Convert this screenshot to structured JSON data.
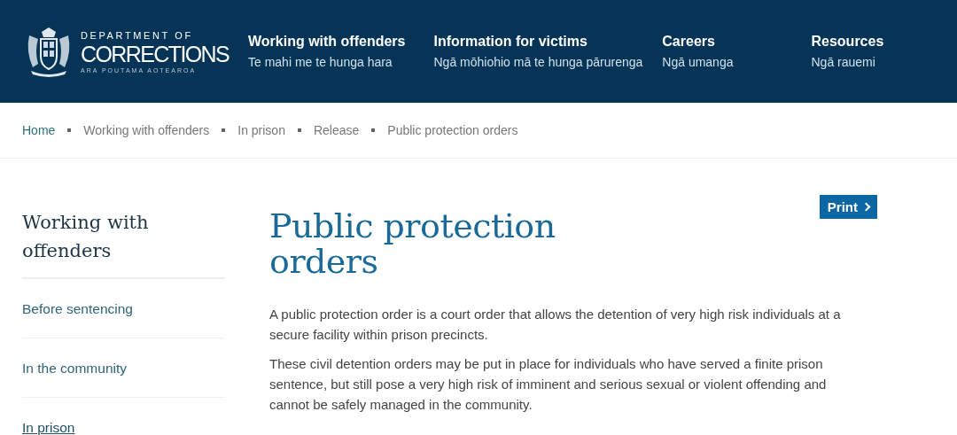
{
  "header": {
    "logo": {
      "line_1": "DEPARTMENT OF",
      "line_2": "CORRECTIONS",
      "line_3": "ARA POUTAMA AOTEAROA"
    },
    "nav": [
      {
        "title": "Working with offenders",
        "subtitle": "Te mahi me te hunga hara"
      },
      {
        "title": "Information for victims",
        "subtitle": "Ngā mōhiohio mā te hunga pārurenga"
      },
      {
        "title": "Careers",
        "subtitle": "Ngā umanga"
      },
      {
        "title": "Resources",
        "subtitle": "Ngā rauemi"
      }
    ]
  },
  "breadcrumb": [
    {
      "label": "Home",
      "link": true
    },
    {
      "label": "Working with offenders",
      "link": false
    },
    {
      "label": "In prison",
      "link": false
    },
    {
      "label": "Release",
      "link": false
    },
    {
      "label": "Public protection orders",
      "link": false
    }
  ],
  "sidebar": {
    "title": "Working with offenders",
    "items": [
      {
        "label": "Before sentencing",
        "selected": false
      },
      {
        "label": "In the community",
        "selected": false
      },
      {
        "label": "In prison",
        "selected": true
      }
    ]
  },
  "main": {
    "title": "Public protection orders",
    "print_button": "Print",
    "paragraphs": [
      "A public protection order is a court order that allows the detention of very high risk individuals at a secure facility within prison precincts.",
      "These civil detention orders may be put in place for individuals who have served a finite prison sentence, but still pose a very high risk of imminent and serious sexual or violent offending and cannot be safely managed in the community."
    ]
  }
}
